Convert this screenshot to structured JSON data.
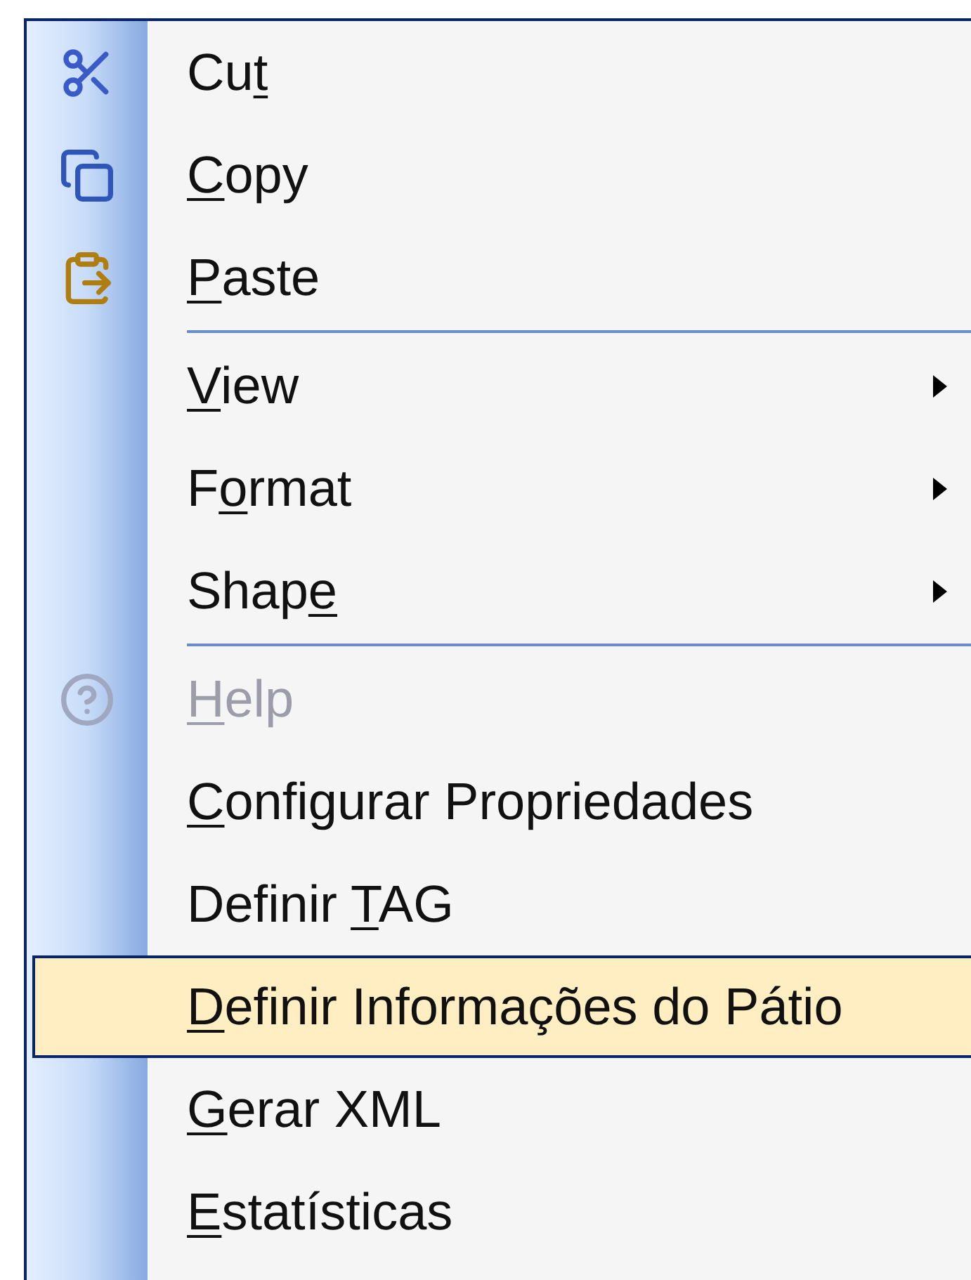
{
  "menu": {
    "items": [
      {
        "kind": "item",
        "label_parts": [
          {
            "text": "Cu",
            "underlined": false
          },
          {
            "text": "t",
            "underlined": true
          }
        ],
        "submenu": false,
        "disabled": false,
        "selected": false
      },
      {
        "kind": "item",
        "label_parts": [
          {
            "text": "C",
            "underlined": true
          },
          {
            "text": "opy",
            "underlined": false
          }
        ],
        "submenu": false,
        "disabled": false,
        "selected": false
      },
      {
        "kind": "item",
        "label_parts": [
          {
            "text": "P",
            "underlined": true
          },
          {
            "text": "aste",
            "underlined": false
          }
        ],
        "submenu": false,
        "disabled": false,
        "selected": false
      },
      {
        "kind": "separator"
      },
      {
        "kind": "item",
        "label_parts": [
          {
            "text": "V",
            "underlined": true
          },
          {
            "text": "iew",
            "underlined": false
          }
        ],
        "submenu": true,
        "disabled": false,
        "selected": false
      },
      {
        "kind": "item",
        "label_parts": [
          {
            "text": "F",
            "underlined": false
          },
          {
            "text": "o",
            "underlined": true
          },
          {
            "text": "rmat",
            "underlined": false
          }
        ],
        "submenu": true,
        "disabled": false,
        "selected": false
      },
      {
        "kind": "item",
        "label_parts": [
          {
            "text": "Shap",
            "underlined": false
          },
          {
            "text": "e",
            "underlined": true
          }
        ],
        "submenu": true,
        "disabled": false,
        "selected": false
      },
      {
        "kind": "separator"
      },
      {
        "kind": "item",
        "label_parts": [
          {
            "text": "H",
            "underlined": true
          },
          {
            "text": "elp",
            "underlined": false
          }
        ],
        "submenu": false,
        "disabled": true,
        "selected": false
      },
      {
        "kind": "item",
        "label_parts": [
          {
            "text": "C",
            "underlined": true
          },
          {
            "text": "onfigurar Propriedades",
            "underlined": false
          }
        ],
        "submenu": false,
        "disabled": false,
        "selected": false
      },
      {
        "kind": "item",
        "label_parts": [
          {
            "text": "Definir ",
            "underlined": false
          },
          {
            "text": "T",
            "underlined": true
          },
          {
            "text": "AG",
            "underlined": false
          }
        ],
        "submenu": false,
        "disabled": false,
        "selected": false
      },
      {
        "kind": "item",
        "label_parts": [
          {
            "text": "D",
            "underlined": true
          },
          {
            "text": "efinir Informações do Pátio",
            "underlined": false
          }
        ],
        "submenu": false,
        "disabled": false,
        "selected": true
      },
      {
        "kind": "item",
        "label_parts": [
          {
            "text": "G",
            "underlined": true
          },
          {
            "text": "erar XML",
            "underlined": false
          }
        ],
        "submenu": false,
        "disabled": false,
        "selected": false
      },
      {
        "kind": "item",
        "label_parts": [
          {
            "text": "E",
            "underlined": true
          },
          {
            "text": "statísticas",
            "underlined": false
          }
        ],
        "submenu": false,
        "disabled": false,
        "selected": false
      }
    ]
  }
}
